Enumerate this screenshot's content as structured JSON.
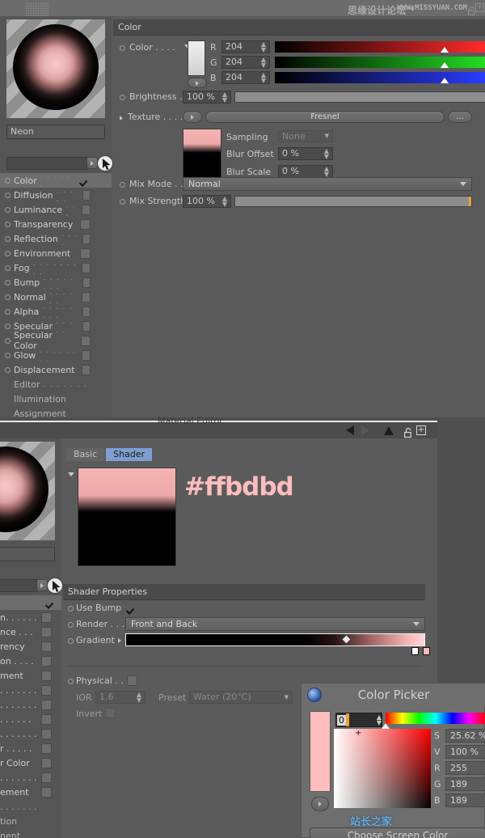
{
  "app": {
    "watermark_cn": "思缘设计论坛",
    "watermark_url": "WWW.MISSYUAN.COM",
    "watermark_bottom": "站长之家"
  },
  "material_editor_1": {
    "window_title": "Material Editor",
    "preview_name": "Neon",
    "search_value": "",
    "channels": [
      {
        "label": "Color",
        "dots": ". . . . . .",
        "selected": true,
        "checked": true
      },
      {
        "label": "Diffusion",
        "dots": ". . . . .",
        "selected": false,
        "checked": false
      },
      {
        "label": "Luminance",
        "dots": ". . .",
        "selected": false,
        "checked": false
      },
      {
        "label": "Transparency",
        "dots": "",
        "selected": false,
        "checked": false
      },
      {
        "label": "Reflection",
        "dots": ". . . .",
        "selected": false,
        "checked": false
      },
      {
        "label": "Environment",
        "dots": "",
        "selected": false,
        "checked": false
      },
      {
        "label": "Fog",
        "dots": ". . . . . . . . .",
        "selected": false,
        "checked": false
      },
      {
        "label": "Bump",
        "dots": ". . . . . . . .",
        "selected": false,
        "checked": false
      },
      {
        "label": "Normal",
        "dots": ". . . . . .",
        "selected": false,
        "checked": false
      },
      {
        "label": "Alpha",
        "dots": ". . . . . . . .",
        "selected": false,
        "checked": false
      },
      {
        "label": "Specular",
        "dots": ". . . . .",
        "selected": false,
        "checked": false
      },
      {
        "label": "Specular Color",
        "dots": "",
        "selected": false,
        "checked": false
      },
      {
        "label": "Glow",
        "dots": ". . . . . . . .",
        "selected": false,
        "checked": false
      },
      {
        "label": "Displacement",
        "dots": "",
        "selected": false,
        "checked": false
      }
    ],
    "sub_items": [
      {
        "label": "Editor",
        "dots": ". . . . . . ."
      },
      {
        "label": "Illumination",
        "dots": ""
      },
      {
        "label": "Assignment",
        "dots": ""
      }
    ],
    "color_section": {
      "header": "Color",
      "color_label": "Color . . . .",
      "channels": [
        {
          "name": "R",
          "value": "204"
        },
        {
          "name": "G",
          "value": "204"
        },
        {
          "name": "B",
          "value": "204"
        }
      ],
      "brightness_label": "Brightness .",
      "brightness_value": "100 %",
      "texture_label": "Texture . . . .",
      "texture_value": "Fresnel",
      "texture_more": "...",
      "sampling_label": "Sampling",
      "sampling_value": "None",
      "blur_offset_label": "Blur Offset",
      "blur_offset_value": "0 %",
      "blur_scale_label": "Blur Scale",
      "blur_scale_value": "0 %",
      "mix_mode_label": "Mix Mode . .",
      "mix_mode_value": "Normal",
      "mix_strength_label": "Mix Strength",
      "mix_strength_value": "100 %"
    }
  },
  "material_editor_2": {
    "window_title": "Material Editor",
    "tabs": [
      {
        "label": "Basic",
        "active": false
      },
      {
        "label": "Shader",
        "active": true
      }
    ],
    "hex_annotation": "#ffbdbd",
    "shader_properties": {
      "header": "Shader Properties",
      "use_bump_label": "Use Bump",
      "use_bump_checked": true,
      "render_label": "Render . . .",
      "render_value": "Front and Back",
      "gradient_label": "Gradient",
      "physical_label": "Physical . . .",
      "physical_checked": false,
      "ior_label": "IOR",
      "ior_value": "1.6",
      "preset_label": "Preset",
      "preset_value": "Water (20°C)",
      "invert_label": "Invert",
      "invert_checked": false
    },
    "clipped_channels": [
      "n. . . . . .",
      "nce . . .",
      "rency",
      "on . . . .",
      "ment",
      ". . . . . . .",
      ". . . . . . .",
      ". . . . . .",
      ". . . . . . .",
      "r . . . . .",
      "r Color",
      ". . . . . . .",
      "ement"
    ],
    "clipped_subs": [
      ". . . . . . .",
      "tion",
      "nent"
    ]
  },
  "color_picker": {
    "title": "Color Picker",
    "hue_value": "0",
    "fields": [
      {
        "name": "S",
        "value": "25.62 %"
      },
      {
        "name": "V",
        "value": "100 %"
      },
      {
        "name": "R",
        "value": "255"
      },
      {
        "name": "G",
        "value": "189"
      },
      {
        "name": "B",
        "value": "189"
      }
    ],
    "screen_color_button": "Choose Screen Color",
    "current_color": "#ffbdbd"
  }
}
